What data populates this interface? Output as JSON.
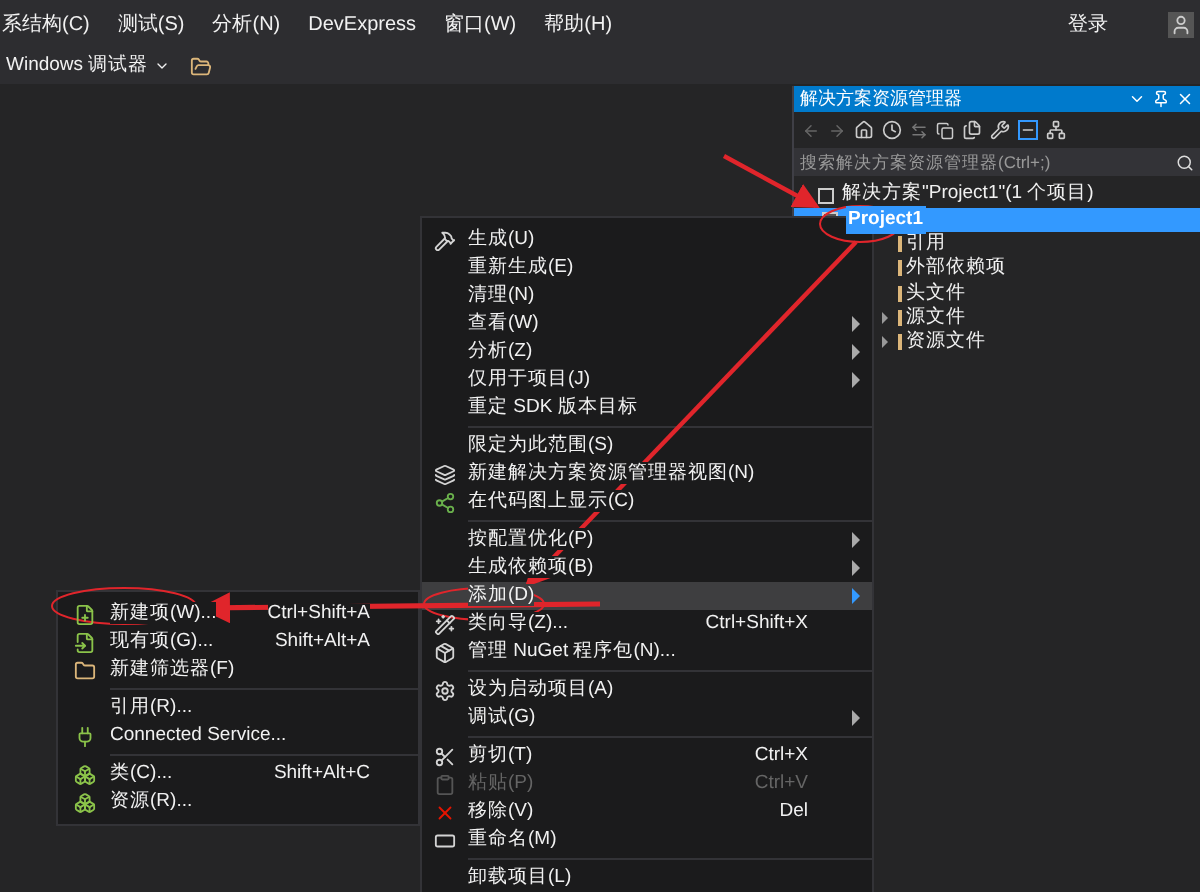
{
  "menu_bar": {
    "items": [
      "系结构(C)",
      "测试(S)",
      "分析(N)",
      "DevExpress",
      "窗口(W)",
      "帮助(H)"
    ],
    "login": "登录"
  },
  "toolbar": {
    "debugger": "Windows 调试器"
  },
  "solution_explorer": {
    "title": "解决方案资源管理器",
    "search": {
      "placeholder": "搜索解决方案资源管理器(Ctrl+;)"
    },
    "tree": {
      "label": "解决方案\"Project1\"(1 个项目)",
      "children": [
        {
          "label": "Project1",
          "selected": true,
          "expanded": true,
          "children": [
            {
              "label": "引用",
              "expandable": false
            },
            {
              "label": "外部依赖项",
              "expandable": false
            },
            {
              "label": "头文件",
              "expandable": false
            },
            {
              "label": "源文件",
              "expandable": true
            },
            {
              "label": "资源文件",
              "expandable": true
            }
          ]
        }
      ]
    }
  },
  "context_menu": {
    "groups": [
      [
        {
          "label": "生成(U)",
          "submenu": false,
          "selected": false,
          "disabled": false
        },
        {
          "label": "重新生成(E)",
          "submenu": false,
          "selected": false,
          "disabled": false
        },
        {
          "label": "清理(N)",
          "submenu": false,
          "selected": false,
          "disabled": false
        },
        {
          "label": "查看(W)",
          "submenu": true,
          "selected": false,
          "disabled": false
        },
        {
          "label": "分析(Z)",
          "submenu": true,
          "selected": false,
          "disabled": false
        },
        {
          "label": "仅用于项目(J)",
          "submenu": true,
          "selected": false,
          "disabled": false
        },
        {
          "label": "重定 SDK 版本目标",
          "submenu": false,
          "selected": false,
          "disabled": false
        }
      ],
      [
        {
          "label": "限定为此范围(S)",
          "submenu": false,
          "selected": false,
          "disabled": false
        },
        {
          "label": "新建解决方案资源管理器视图(N)",
          "submenu": false,
          "selected": false,
          "disabled": false
        },
        {
          "label": "在代码图上显示(C)",
          "submenu": false,
          "selected": false,
          "disabled": false
        }
      ],
      [
        {
          "label": "按配置优化(P)",
          "submenu": true,
          "selected": false,
          "disabled": false
        },
        {
          "label": "生成依赖项(B)",
          "submenu": true,
          "selected": false,
          "disabled": false
        },
        {
          "label": "添加(D)",
          "submenu": true,
          "selected": true,
          "disabled": false
        },
        {
          "label": "类向导(Z)...",
          "shortcut": "Ctrl+Shift+X",
          "submenu": false,
          "selected": false,
          "disabled": false
        },
        {
          "label": "管理 NuGet 程序包(N)...",
          "submenu": false,
          "selected": false,
          "disabled": false
        }
      ],
      [
        {
          "label": "设为启动项目(A)",
          "submenu": false,
          "selected": false,
          "disabled": false
        },
        {
          "label": "调试(G)",
          "submenu": true,
          "selected": false,
          "disabled": false
        }
      ],
      [
        {
          "label": "剪切(T)",
          "shortcut": "Ctrl+X",
          "submenu": false,
          "selected": false,
          "disabled": false
        },
        {
          "label": "粘贴(P)",
          "shortcut": "Ctrl+V",
          "submenu": false,
          "selected": false,
          "disabled": true
        },
        {
          "label": "移除(V)",
          "shortcut": "Del",
          "submenu": false,
          "selected": false,
          "disabled": false
        },
        {
          "label": "重命名(M)",
          "submenu": false,
          "selected": false,
          "disabled": false
        }
      ],
      [
        {
          "label": "卸载项目(L)",
          "submenu": false,
          "selected": false,
          "disabled": false
        }
      ]
    ]
  },
  "add_submenu": {
    "groups": [
      [
        {
          "label": "新建项(W)...",
          "shortcut": "Ctrl+Shift+A",
          "selected": false
        },
        {
          "label": "现有项(G)...",
          "shortcut": "Shift+Alt+A",
          "selected": false
        },
        {
          "label": "新建筛选器(F)",
          "selected": false
        }
      ],
      [
        {
          "label": "引用(R)...",
          "selected": false
        },
        {
          "label": "Connected Service...",
          "selected": false
        }
      ],
      [
        {
          "label": "类(C)...",
          "shortcut": "Shift+Alt+C",
          "selected": false
        },
        {
          "label": "资源(R)...",
          "selected": false
        }
      ]
    ]
  }
}
